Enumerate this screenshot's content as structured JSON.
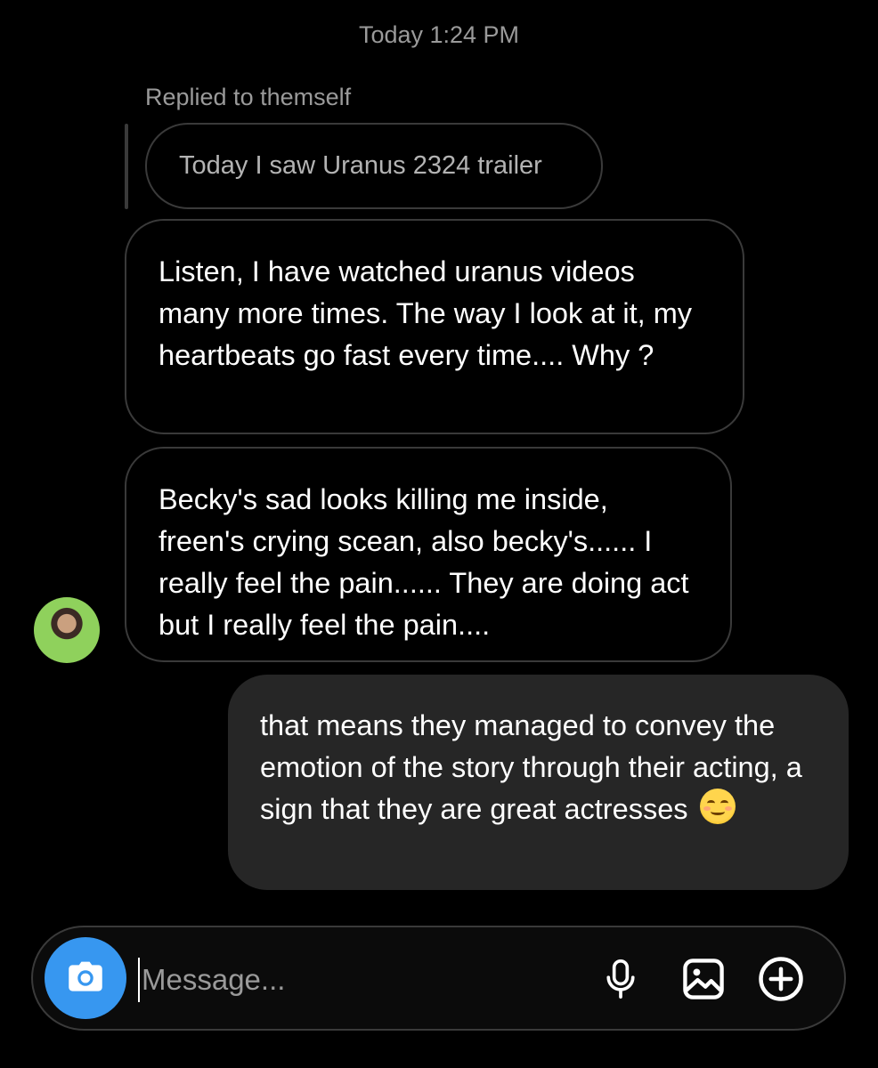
{
  "header": {
    "timestamp": "Today 1:24 PM"
  },
  "reply": {
    "label": "Replied to themself",
    "quoted_text": "Today I saw Uranus 2324 trailer"
  },
  "messages": [
    {
      "direction": "incoming",
      "text": "Listen, I have watched uranus videos many more times. The way I look at it, my heartbeats go fast every time.... Why ?"
    },
    {
      "direction": "incoming",
      "text": "Becky's sad looks killing me inside, freen's crying scean, also becky's...... I really feel the pain...... They are doing act but I really feel the pain...."
    },
    {
      "direction": "outgoing",
      "text": "that means they managed to convey the emotion of the story through their acting, a sign that they are great actresses",
      "emoji": "smiling-face-with-blush"
    }
  ],
  "composer": {
    "placeholder": "Message...",
    "camera_icon": "camera-icon",
    "mic_icon": "microphone-icon",
    "gallery_icon": "gallery-icon",
    "plus_icon": "plus-circle-icon"
  },
  "colors": {
    "background": "#000000",
    "outgoing_bubble": "#262626",
    "accent": "#3797f0",
    "muted_text": "#9a9a9a"
  }
}
